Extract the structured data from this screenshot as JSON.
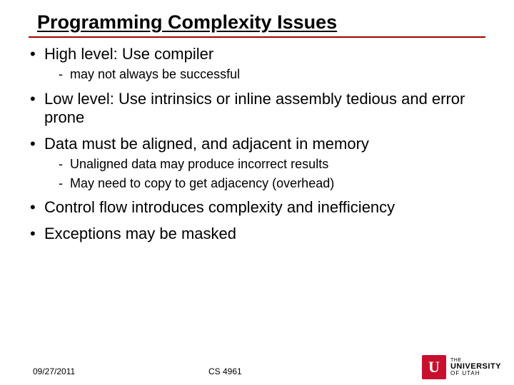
{
  "title": "Programming Complexity Issues",
  "bullets": {
    "b0": {
      "text": "High level: Use compiler",
      "sub": {
        "s0": "may not always be successful"
      }
    },
    "b1": {
      "text": "Low level: Use intrinsics or inline assembly tedious and error prone"
    },
    "b2": {
      "text": "Data must be aligned, and adjacent in memory",
      "sub": {
        "s0": "Unaligned data may produce incorrect results",
        "s1": "May need to copy to get adjacency (overhead)"
      }
    },
    "b3": {
      "text": "Control flow introduces complexity and inefficiency"
    },
    "b4": {
      "text": "Exceptions may be masked"
    }
  },
  "footer": {
    "date": "09/27/2011",
    "course": "CS 4961"
  },
  "logo": {
    "glyph": "U",
    "line1": "THE",
    "line2": "UNIVERSITY",
    "line3": "OF UTAH"
  }
}
